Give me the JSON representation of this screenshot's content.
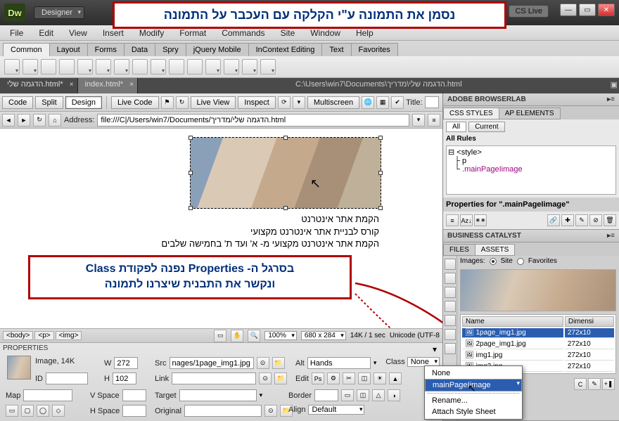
{
  "annotations": {
    "top": "נסמן את התמונה ע\"י הקלקה עם העכבר על התמונה",
    "mid_line1": "בסרגל ה- Properties נפנה לפקודת Class",
    "mid_line2": "ונקשר את התבנית שיצרנו לתמונה"
  },
  "title": {
    "layout_label": "Designer",
    "cs_live": "CS Live"
  },
  "menus": [
    "File",
    "Edit",
    "View",
    "Insert",
    "Modify",
    "Format",
    "Commands",
    "Site",
    "Window",
    "Help"
  ],
  "insert_tabs": [
    "Common",
    "Layout",
    "Forms",
    "Data",
    "Spry",
    "jQuery Mobile",
    "InContext Editing",
    "Text",
    "Favorites"
  ],
  "doc_tabs": [
    {
      "label": "הדגמה שלי.html*",
      "active": false
    },
    {
      "label": "index.html*",
      "active": true
    }
  ],
  "doc_path": "C:\\Users\\win7\\Documents\\הדגמה שלי\\מדריך.html",
  "doc_toolbar": {
    "code": "Code",
    "split": "Split",
    "design": "Design",
    "live_code": "Live Code",
    "live_view": "Live View",
    "inspect": "Inspect",
    "multiscreen": "Multiscreen",
    "title_label": "Title:"
  },
  "address": {
    "label": "Address:",
    "value": "file:///C|/Users/win7/Documents/הדגמה שלי/מדריך.html"
  },
  "page_text": {
    "l1": "הקמת אתר אינטרנט",
    "l2": "קורס לבניית אתר אינטרנט מקצועי",
    "l3": "הקמת אתר אינטרנט מקצועי מ- א' ועד ת' בחמישה שלבים"
  },
  "status": {
    "tags": [
      "<body>",
      "<p>",
      "<img>"
    ],
    "zoom": "100%",
    "dims": "680 x 284",
    "weight": "14K / 1 sec",
    "encoding": "Unicode (UTF-8"
  },
  "properties": {
    "panel_title": "PROPERTIES",
    "type": "Image, 14K",
    "w_label": "W",
    "w": "272",
    "h_label": "H",
    "h": "102",
    "id_label": "ID",
    "id": "",
    "src_label": "Src",
    "src": "nages/1page_img1.jpg",
    "link_label": "Link",
    "link": "",
    "alt_label": "Alt",
    "alt": "Hands",
    "edit_label": "Edit",
    "class_label": "Class",
    "class_value": "None",
    "map_label": "Map",
    "map": "",
    "vspace_label": "V Space",
    "vspace": "",
    "hspace_label": "H Space",
    "hspace": "",
    "target_label": "Target",
    "target": "",
    "original_label": "Original",
    "original": "",
    "border_label": "Border",
    "border": "",
    "align_label": "Align",
    "align": "Default"
  },
  "class_menu": {
    "items": [
      "None",
      "mainPageIimage"
    ],
    "rename": "Rename...",
    "attach": "Attach Style Sheet"
  },
  "panels": {
    "browserlab": "ADOBE BROWSERLAB",
    "css_styles": "CSS STYLES",
    "ap_elements": "AP ELEMENTS",
    "all": "All",
    "current": "Current",
    "all_rules": "All Rules",
    "rule_style": "<style>",
    "rule_p": "p",
    "rule_class": ".mainPageIimage",
    "props_for": "Properties for \".mainPageIimage\"",
    "biz": "BUSINESS CATALYST",
    "files": "FILES",
    "assets": "ASSETS",
    "images_label": "Images:",
    "site": "Site",
    "favorites": "Favorites",
    "cols": {
      "name": "Name",
      "dim": "Dimensi"
    },
    "rows": [
      {
        "name": "1page_img1.jpg",
        "dim": "272x10"
      },
      {
        "name": "2page_img1.jpg",
        "dim": "272x10"
      },
      {
        "name": "img1.jpg",
        "dim": "272x10"
      },
      {
        "name": "img2.jpg",
        "dim": "272x10"
      }
    ]
  }
}
